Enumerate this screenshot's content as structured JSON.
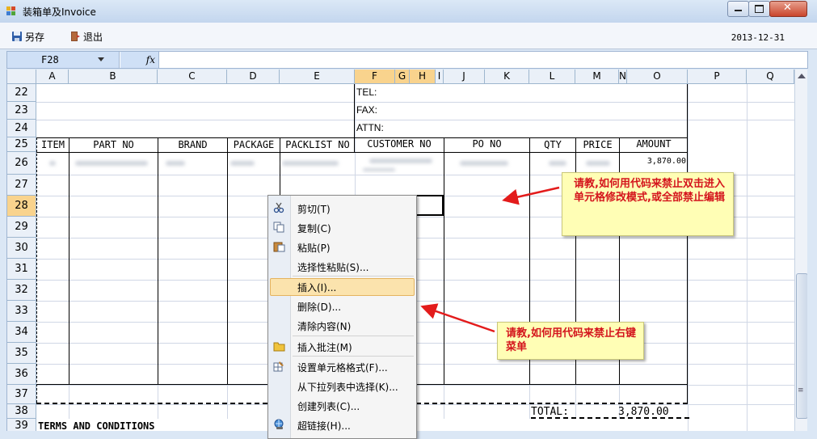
{
  "window": {
    "title": "装箱单及Invoice"
  },
  "toolbar": {
    "save_as_label": "另存",
    "exit_label": "退出",
    "date": "2013-12-31"
  },
  "formula_bar": {
    "name_box": "F28",
    "fx_label": "fx",
    "formula": ""
  },
  "columns": [
    "A",
    "B",
    "C",
    "D",
    "E",
    "F",
    "G",
    "H",
    "I",
    "J",
    "K",
    "L",
    "M",
    "N",
    "O",
    "P",
    "Q"
  ],
  "rows": [
    "22",
    "23",
    "24",
    "25",
    "26",
    "27",
    "28",
    "29",
    "30",
    "31",
    "32",
    "33",
    "34",
    "35",
    "36",
    "37",
    "38",
    "39"
  ],
  "sheet": {
    "tel_label": "TEL:",
    "fax_label": "FAX:",
    "attn_label": "ATTN:",
    "headers": [
      "ITEM",
      "PART NO",
      "BRAND",
      "PACKAGE",
      "PACKLIST NO",
      "CUSTOMER NO",
      "PO NO",
      "QTY",
      "PRICE",
      "AMOUNT"
    ],
    "row26_amount": "3,870.00",
    "total_label": "TOTAL:",
    "total_value": "3,870.00",
    "terms_label": "TERMS AND CONDITIONS"
  },
  "context_menu": {
    "items": [
      {
        "label": "剪切(T)",
        "icon": "scissors-icon"
      },
      {
        "label": "复制(C)",
        "icon": "copy-icon"
      },
      {
        "label": "粘贴(P)",
        "icon": "paste-icon"
      },
      {
        "label": "选择性粘贴(S)...",
        "icon": ""
      },
      {
        "label": "插入(I)...",
        "icon": ""
      },
      {
        "label": "删除(D)...",
        "icon": ""
      },
      {
        "label": "清除内容(N)",
        "icon": ""
      },
      {
        "label": "插入批注(M)",
        "icon": "folder-icon"
      },
      {
        "label": "设置单元格格式(F)...",
        "icon": "format-icon"
      },
      {
        "label": "从下拉列表中选择(K)...",
        "icon": ""
      },
      {
        "label": "创建列表(C)...",
        "icon": ""
      },
      {
        "label": "超链接(H)...",
        "icon": "hyperlink-icon"
      }
    ],
    "highlighted_index": 4
  },
  "callouts": {
    "edit_question": "请教,如何用代码来禁止双击进入单元格修改模式,或全部禁止编辑",
    "menu_question": "请教,如何用代码来禁止右键菜单"
  },
  "colors": {
    "selection_header": "#f9d38d",
    "callout_text": "#d4141c",
    "arrow": "#e31b1b"
  }
}
